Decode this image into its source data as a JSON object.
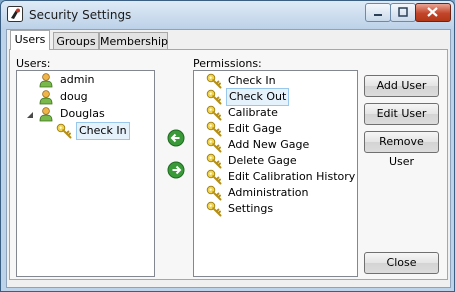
{
  "window": {
    "title": "Security Settings"
  },
  "tabs": [
    "Users",
    "Groups",
    "Membership"
  ],
  "users_panel": {
    "label": "Users:",
    "items": [
      {
        "label": "admin",
        "icon": "user-icon"
      },
      {
        "label": "doug",
        "icon": "user-icon"
      },
      {
        "label": "Douglas",
        "icon": "user-icon",
        "expanded": true,
        "children": [
          {
            "label": "Check In",
            "icon": "key-icon",
            "selected": true
          }
        ]
      }
    ]
  },
  "permissions_panel": {
    "label": "Permissions:",
    "items": [
      "Check In",
      "Check Out",
      "Calibrate",
      "Edit Gage",
      "Add New Gage",
      "Delete Gage",
      "Edit Calibration History",
      "Administration",
      "Settings"
    ],
    "selected_index": 1
  },
  "buttons": {
    "add_user": "Add User",
    "edit_user": "Edit User",
    "remove_user": "Remove User",
    "close": "Close"
  },
  "colors": {
    "arrow": "#3a9a3a",
    "title_bg": "#bcd1e8",
    "close_button": "#c2452b"
  }
}
